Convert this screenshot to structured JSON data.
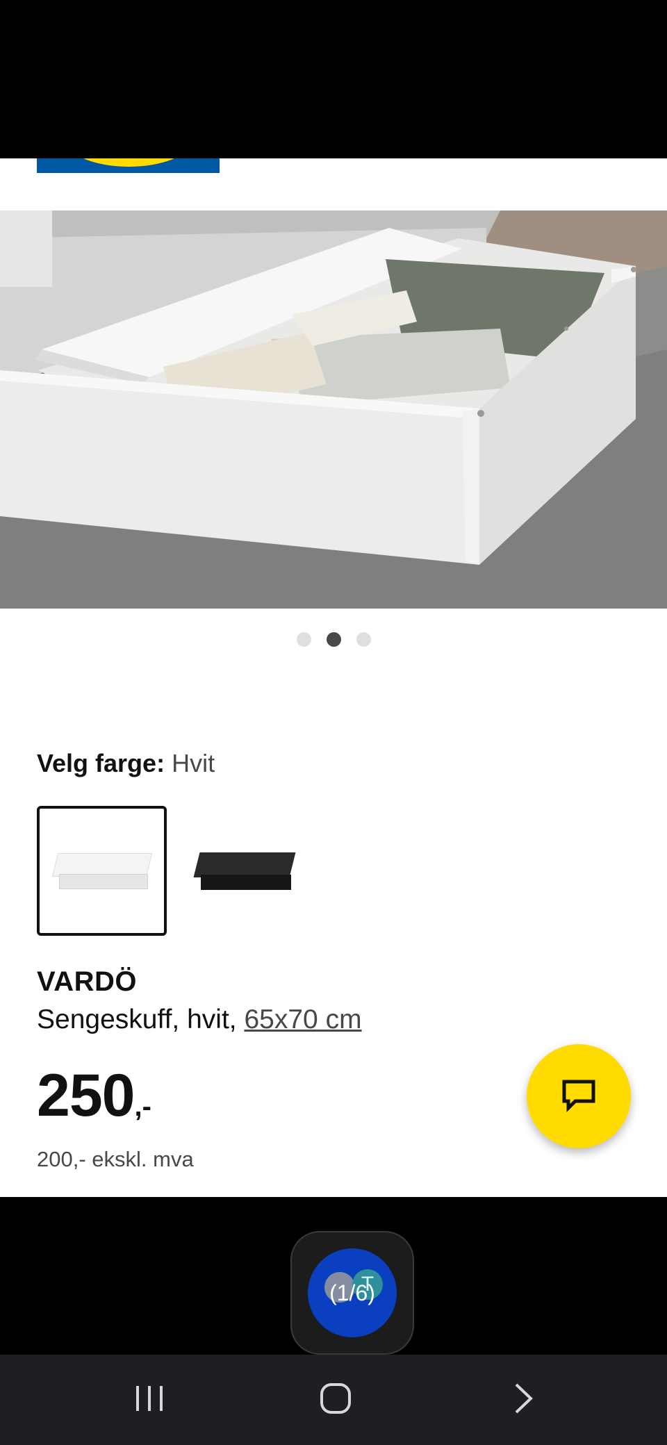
{
  "image": {
    "carousel": {
      "total_dots": 3,
      "active_index": 1
    }
  },
  "color_select": {
    "label": "Velg farge:",
    "value": "Hvit",
    "options": [
      {
        "name": "white-swatch",
        "selected": true,
        "color": "#f4f4f4"
      },
      {
        "name": "black-swatch",
        "selected": false,
        "color": "#1e1e1e"
      }
    ]
  },
  "product": {
    "name": "VARDÖ",
    "description": "Sengeskuff, hvit,",
    "size": "65x70 cm",
    "price_integer": "250",
    "price_suffix": ",-",
    "price_ex_vat": "200,- ekskl. mva"
  },
  "chat": {
    "icon": "chat-bubble-icon",
    "color": "#ffdb00"
  },
  "floating_bubble": {
    "count": "(1/6)",
    "badge_letter": "T",
    "color": "#0a3fbf"
  },
  "navigation": {
    "recent_icon": "recent-apps-icon",
    "home_icon": "home-icon",
    "back_icon": "back-icon"
  },
  "brand": {
    "blue": "#0058a3",
    "yellow": "#ffdb00"
  }
}
